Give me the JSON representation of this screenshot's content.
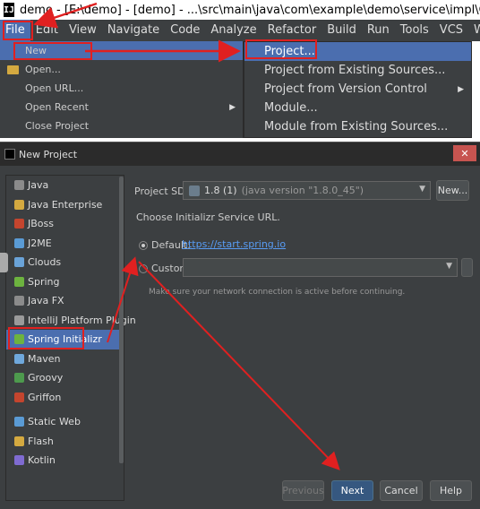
{
  "window": {
    "logo": "IJ",
    "title": "demo - [E:\\demo] - [demo] - ...\\src\\main\\java\\com\\example\\demo\\service\\impl\\OrderM"
  },
  "menubar": [
    "File",
    "Edit",
    "View",
    "Navigate",
    "Code",
    "Analyze",
    "Refactor",
    "Build",
    "Run",
    "Tools",
    "VCS",
    "Windo"
  ],
  "file_menu": {
    "items": [
      {
        "label": "New",
        "submenu": true,
        "selected": true
      },
      {
        "label": "Open...",
        "icon": "folder-icon"
      },
      {
        "label": "Open URL..."
      },
      {
        "label": "Open Recent",
        "submenu": true
      },
      {
        "label": "Close Project"
      }
    ]
  },
  "new_submenu": {
    "items": [
      {
        "label": "Project...",
        "selected": true
      },
      {
        "label": "Project from Existing Sources..."
      },
      {
        "label": "Project from Version Control",
        "submenu": true
      },
      {
        "label": "Module..."
      },
      {
        "label": "Module from Existing Sources..."
      }
    ]
  },
  "dialog": {
    "title": "New Project",
    "project_types": [
      {
        "label": "Java",
        "color": "#8b8b8b"
      },
      {
        "label": "Java Enterprise",
        "color": "#d4a940"
      },
      {
        "label": "JBoss",
        "color": "#c4452e"
      },
      {
        "label": "J2ME",
        "color": "#5a9bd5"
      },
      {
        "label": "Clouds",
        "color": "#6aa3d8"
      },
      {
        "label": "Spring",
        "color": "#6db33f"
      },
      {
        "label": "Java FX",
        "color": "#8b8b8b"
      },
      {
        "label": "IntelliJ Platform Plugin",
        "color": "#9a9a9a"
      },
      {
        "label": "Spring Initializr",
        "color": "#6db33f",
        "selected": true
      },
      {
        "label": "Maven",
        "color": "#6fa8dc"
      },
      {
        "label": "Groovy",
        "color": "#4d9a4d"
      },
      {
        "label": "Griffon",
        "color": "#c4452e"
      },
      {
        "label": "Static Web",
        "color": "#5a9bd5"
      },
      {
        "label": "Flash",
        "color": "#d4a940"
      },
      {
        "label": "Kotlin",
        "color": "#7f6bd1"
      }
    ],
    "sdk_label": "Project SDK:",
    "sdk_value": "1.8 (1)",
    "sdk_detail": "(java version \"1.8.0_45\")",
    "new_button": "New...",
    "service_heading": "Choose Initializr Service URL.",
    "default_label": "Default:",
    "default_url": "https://start.spring.io",
    "custom_label": "Custom:",
    "hint": "Make sure your network connection is active before continuing.",
    "buttons": {
      "previous": "Previous",
      "next": "Next",
      "cancel": "Cancel",
      "help": "Help"
    }
  },
  "colors": {
    "accent": "#4b6eaf",
    "annotation": "#e02020"
  }
}
